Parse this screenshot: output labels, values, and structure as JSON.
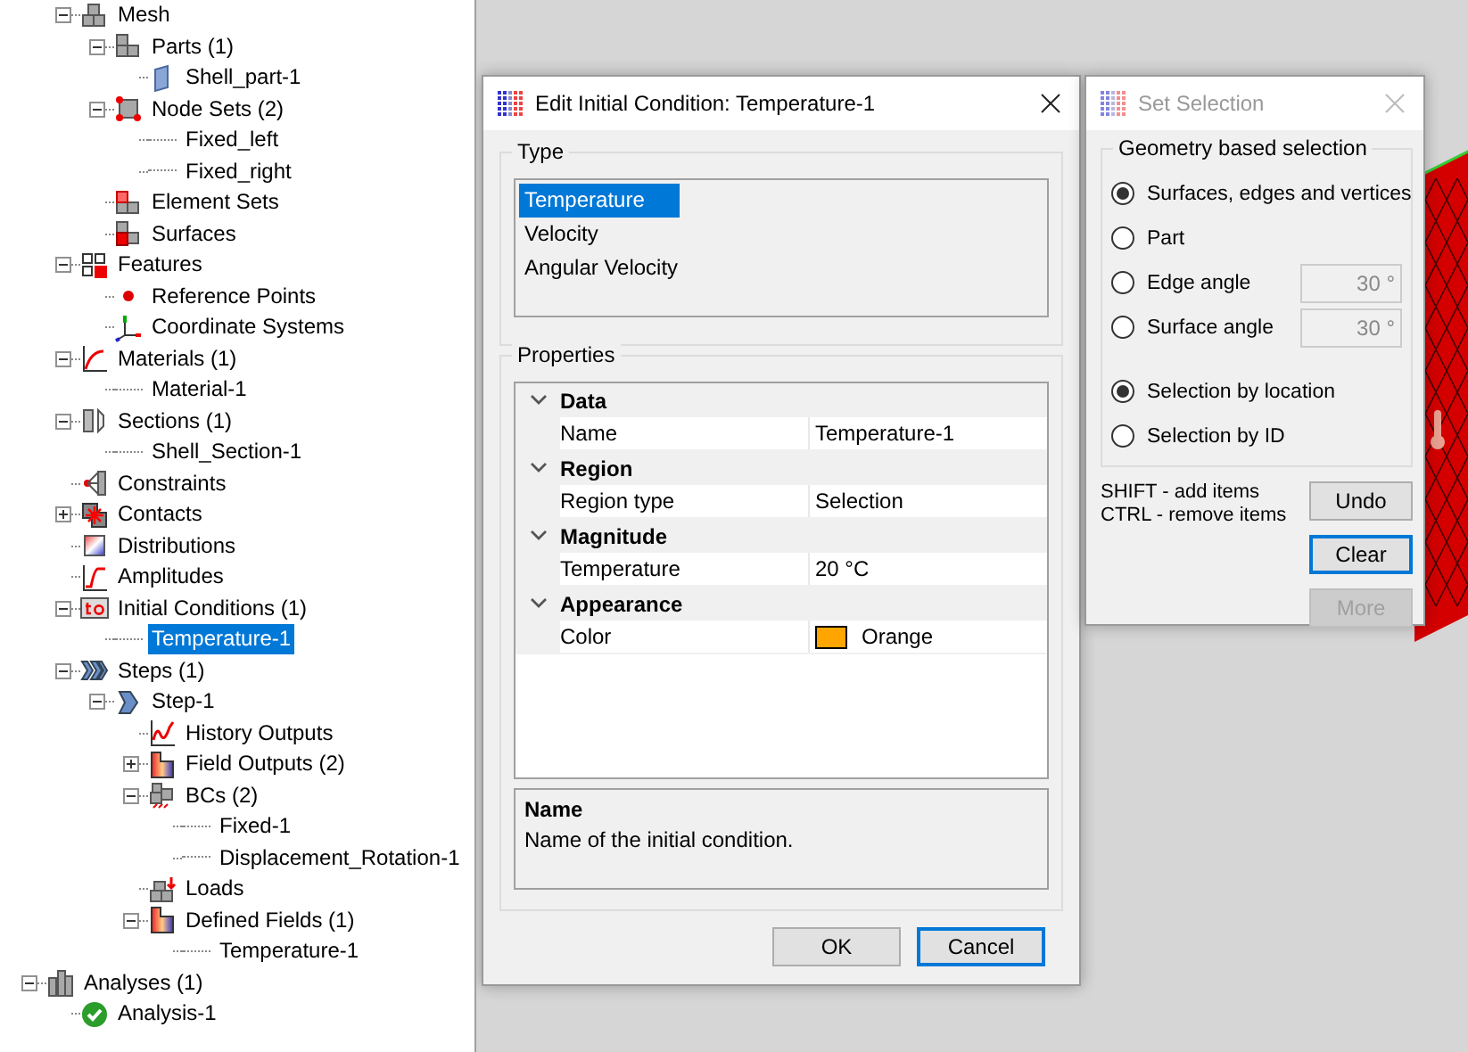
{
  "tree": {
    "model_items": [
      {
        "label": "Mesh",
        "kind": "mesh",
        "expanded": true,
        "selected": false,
        "children": [
          {
            "label": "Parts (1)",
            "kind": "parts",
            "expanded": true,
            "selected": false,
            "children": [
              {
                "label": "Shell_part-1",
                "kind": "part",
                "selected": false
              }
            ]
          },
          {
            "label": "Node Sets (2)",
            "kind": "nodesets",
            "expanded": true,
            "selected": false,
            "children": [
              {
                "label": "Fixed_left",
                "selected": false
              },
              {
                "label": "Fixed_right",
                "selected": false
              }
            ]
          },
          {
            "label": "Element Sets",
            "kind": "elementsets",
            "selected": false
          },
          {
            "label": "Surfaces",
            "kind": "surfaces",
            "selected": false
          }
        ]
      },
      {
        "label": "Features",
        "kind": "features",
        "expanded": true,
        "selected": false,
        "children": [
          {
            "label": "Reference Points",
            "kind": "refpoint",
            "selected": false
          },
          {
            "label": "Coordinate Systems",
            "kind": "csys",
            "selected": false
          }
        ]
      },
      {
        "label": "Materials (1)",
        "kind": "materials",
        "expanded": true,
        "selected": false,
        "children": [
          {
            "label": "Material-1",
            "selected": false
          }
        ]
      },
      {
        "label": "Sections (1)",
        "kind": "sections",
        "expanded": true,
        "selected": false,
        "children": [
          {
            "label": "Shell_Section-1",
            "selected": false
          }
        ]
      },
      {
        "label": "Constraints",
        "kind": "constraints",
        "selected": false
      },
      {
        "label": "Contacts",
        "kind": "contacts",
        "expanded": false,
        "selected": false
      },
      {
        "label": "Distributions",
        "kind": "distributions",
        "selected": false
      },
      {
        "label": "Amplitudes",
        "kind": "amplitudes",
        "selected": false
      },
      {
        "label": "Initial Conditions (1)",
        "kind": "initcond",
        "expanded": true,
        "selected": false,
        "children": [
          {
            "label": "Temperature-1",
            "selected": true
          }
        ]
      },
      {
        "label": "Steps (1)",
        "kind": "steps",
        "expanded": true,
        "selected": false,
        "children": [
          {
            "label": "Step-1",
            "kind": "step",
            "expanded": true,
            "selected": false,
            "children": [
              {
                "label": "History Outputs",
                "kind": "history",
                "selected": false
              },
              {
                "label": "Field Outputs (2)",
                "kind": "fields",
                "expanded": false,
                "selected": false
              },
              {
                "label": "BCs (2)",
                "kind": "bcs",
                "expanded": true,
                "selected": false,
                "children": [
                  {
                    "label": "Fixed-1",
                    "selected": false
                  },
                  {
                    "label": "Displacement_Rotation-1",
                    "selected": false
                  }
                ]
              },
              {
                "label": "Loads",
                "kind": "loads",
                "selected": false
              },
              {
                "label": "Defined Fields (1)",
                "kind": "fields",
                "expanded": true,
                "selected": false,
                "children": [
                  {
                    "label": "Temperature-1",
                    "selected": false
                  }
                ]
              }
            ]
          }
        ]
      }
    ],
    "roots": [
      {
        "label": "Analyses (1)",
        "kind": "analyses",
        "expanded": true,
        "selected": false,
        "children": [
          {
            "label": "Analysis-1",
            "kind": "analysis",
            "selected": false
          }
        ]
      }
    ]
  },
  "edit_dialog": {
    "title": "Edit Initial Condition: Temperature-1",
    "active": true,
    "type_group": {
      "label": "Type",
      "items": [
        {
          "label": "Temperature",
          "selected": true
        },
        {
          "label": "Velocity",
          "selected": false
        },
        {
          "label": "Angular Velocity",
          "selected": false
        }
      ]
    },
    "properties_group": {
      "label": "Properties",
      "sections": [
        {
          "label": "Data",
          "expanded": true,
          "rows": [
            {
              "name": "Name",
              "value": "Temperature-1"
            }
          ]
        },
        {
          "label": "Region",
          "expanded": true,
          "rows": [
            {
              "name": "Region type",
              "value": "Selection"
            }
          ]
        },
        {
          "label": "Magnitude",
          "expanded": true,
          "rows": [
            {
              "name": "Temperature",
              "value": "20 °C"
            }
          ]
        },
        {
          "label": "Appearance",
          "expanded": true,
          "rows": [
            {
              "name": "Color",
              "value": "Orange",
              "color": "#ffa500"
            }
          ]
        }
      ],
      "description": {
        "title": "Name",
        "text": "Name of the initial condition."
      }
    },
    "buttons": [
      {
        "label": "OK",
        "default": false
      },
      {
        "label": "Cancel",
        "default": true
      }
    ]
  },
  "selection_dialog": {
    "title": "Set Selection",
    "active": false,
    "group_label": "Geometry based selection",
    "geometry_options": [
      {
        "label": "Surfaces, edges and vertices",
        "selected": true
      },
      {
        "label": "Part",
        "selected": false
      },
      {
        "label": "Edge angle",
        "selected": false,
        "field": "30 °"
      },
      {
        "label": "Surface angle",
        "selected": false,
        "field": "30 °"
      }
    ],
    "mode_options": [
      {
        "label": "Selection by location",
        "selected": true
      },
      {
        "label": "Selection by ID",
        "selected": false
      }
    ],
    "hints": [
      "SHIFT - add items",
      "CTRL - remove items"
    ],
    "buttons": [
      {
        "label": "Undo",
        "disabled": false,
        "default": false
      },
      {
        "label": "Clear",
        "disabled": false,
        "default": true
      },
      {
        "label": "More",
        "disabled": true,
        "default": false
      }
    ]
  }
}
